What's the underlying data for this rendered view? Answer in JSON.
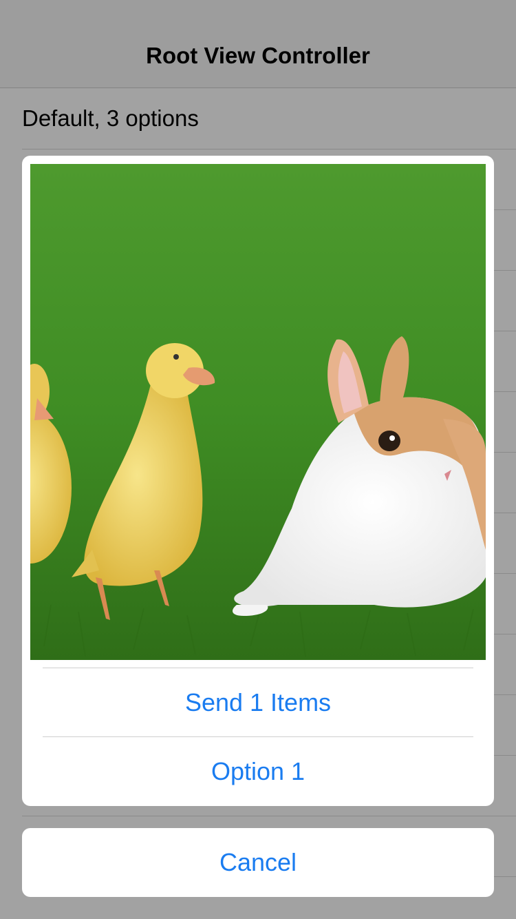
{
  "navbar": {
    "title": "Root View Controller"
  },
  "table": {
    "rows": [
      {
        "label": "Default, 3 options"
      },
      {
        "label": ""
      },
      {
        "label": ""
      },
      {
        "label": ""
      },
      {
        "label": ""
      },
      {
        "label": ""
      },
      {
        "label": ""
      },
      {
        "label": ""
      },
      {
        "label": ""
      },
      {
        "label": ""
      },
      {
        "label": ""
      },
      {
        "label": ""
      },
      {
        "label": ""
      }
    ]
  },
  "action_sheet": {
    "image": {
      "subject": "ducklings-and-rabbit-on-grass"
    },
    "buttons": [
      {
        "label": "Send 1 Items"
      },
      {
        "label": "Option 1"
      }
    ],
    "cancel_label": "Cancel",
    "tint_color": "#1a7cf0"
  }
}
